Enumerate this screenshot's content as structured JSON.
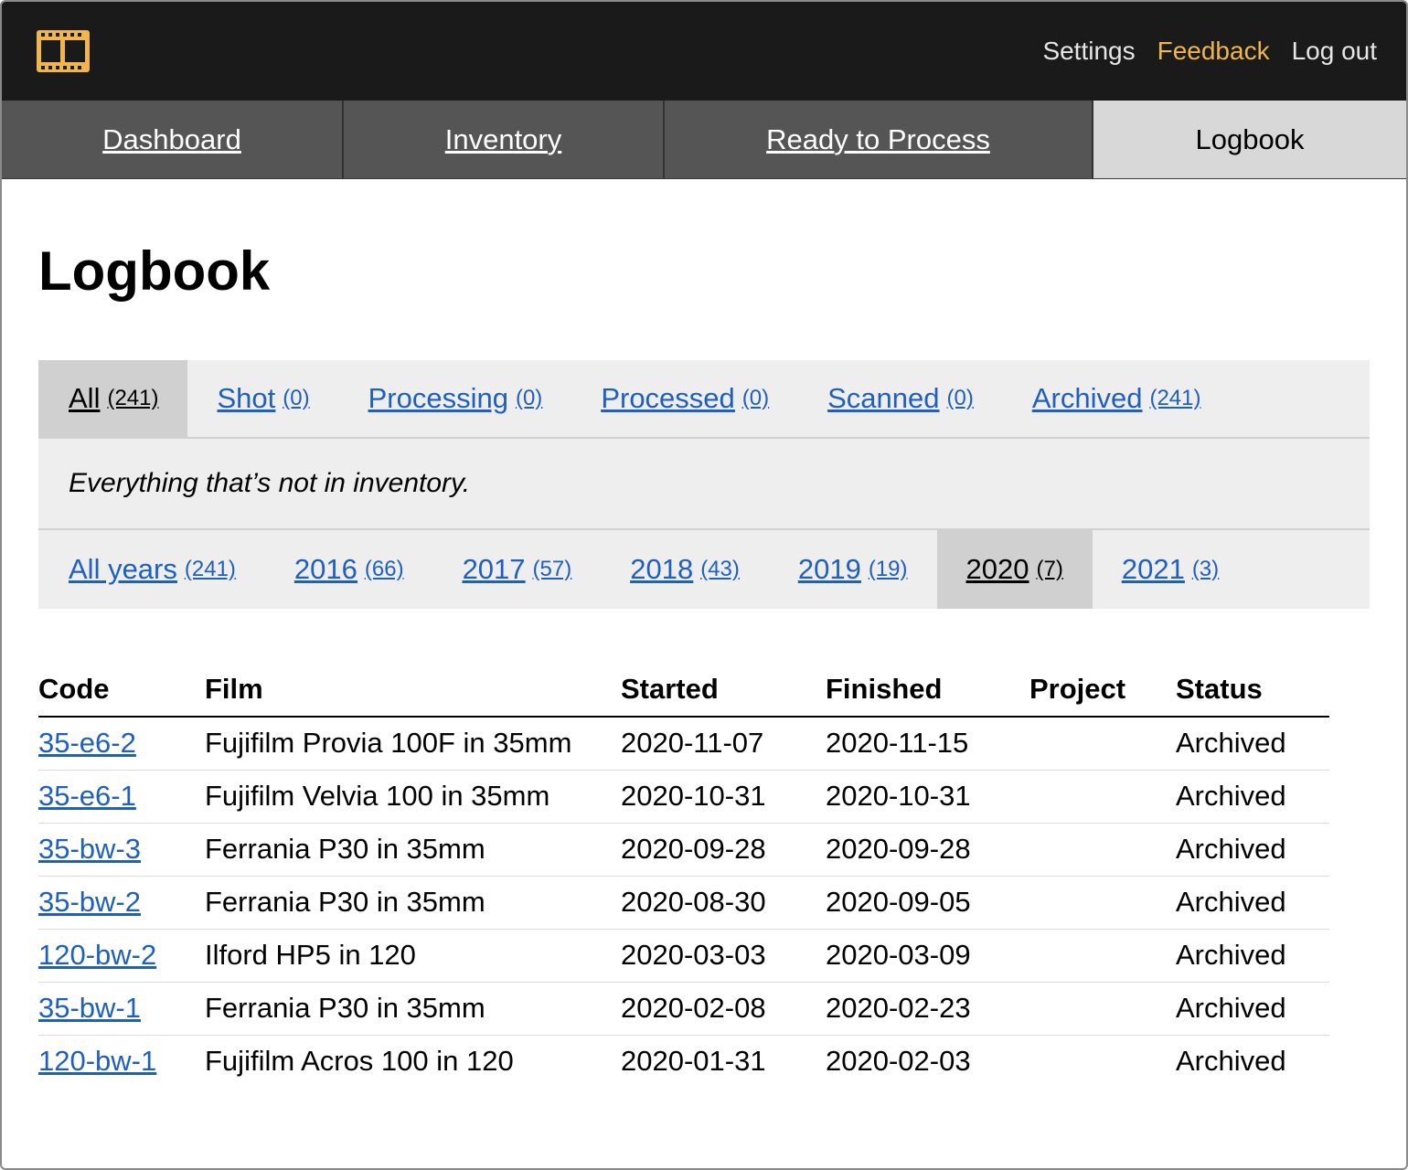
{
  "topbar": {
    "logo_icon": "film-strip-icon",
    "links": {
      "settings": "Settings",
      "feedback": "Feedback",
      "logout": "Log out"
    },
    "accent_color": "#f0b64b"
  },
  "nav": {
    "items": [
      {
        "label": "Dashboard"
      },
      {
        "label": "Inventory"
      },
      {
        "label": "Ready to Process"
      },
      {
        "label": "Logbook"
      }
    ],
    "active": "Logbook"
  },
  "page": {
    "title": "Logbook"
  },
  "status_tabs": [
    {
      "label": "All",
      "count": "(241)"
    },
    {
      "label": "Shot",
      "count": "(0)"
    },
    {
      "label": "Processing",
      "count": "(0)"
    },
    {
      "label": "Processed",
      "count": "(0)"
    },
    {
      "label": "Scanned",
      "count": "(0)"
    },
    {
      "label": "Archived",
      "count": "(241)"
    }
  ],
  "status_active": "All",
  "description": "Everything that’s not in inventory.",
  "year_tabs": [
    {
      "label": "All years",
      "count": "(241)"
    },
    {
      "label": "2016",
      "count": "(66)"
    },
    {
      "label": "2017",
      "count": "(57)"
    },
    {
      "label": "2018",
      "count": "(43)"
    },
    {
      "label": "2019",
      "count": "(19)"
    },
    {
      "label": "2020",
      "count": "(7)"
    },
    {
      "label": "2021",
      "count": "(3)"
    }
  ],
  "year_active": "2020",
  "table": {
    "headers": {
      "code": "Code",
      "film": "Film",
      "started": "Started",
      "finished": "Finished",
      "project": "Project",
      "status": "Status"
    },
    "rows": [
      {
        "code": "35-e6-2",
        "film": "Fujifilm Provia 100F in 35mm",
        "started": "2020-11-07",
        "finished": "2020-11-15",
        "project": "",
        "status": "Archived"
      },
      {
        "code": "35-e6-1",
        "film": "Fujifilm Velvia 100 in 35mm",
        "started": "2020-10-31",
        "finished": "2020-10-31",
        "project": "",
        "status": "Archived"
      },
      {
        "code": "35-bw-3",
        "film": "Ferrania P30 in 35mm",
        "started": "2020-09-28",
        "finished": "2020-09-28",
        "project": "",
        "status": "Archived"
      },
      {
        "code": "35-bw-2",
        "film": "Ferrania P30 in 35mm",
        "started": "2020-08-30",
        "finished": "2020-09-05",
        "project": "",
        "status": "Archived"
      },
      {
        "code": "120-bw-2",
        "film": "Ilford HP5 in 120",
        "started": "2020-03-03",
        "finished": "2020-03-09",
        "project": "",
        "status": "Archived"
      },
      {
        "code": "35-bw-1",
        "film": "Ferrania P30 in 35mm",
        "started": "2020-02-08",
        "finished": "2020-02-23",
        "project": "",
        "status": "Archived"
      },
      {
        "code": "120-bw-1",
        "film": "Fujifilm Acros 100 in 120",
        "started": "2020-01-31",
        "finished": "2020-02-03",
        "project": "",
        "status": "Archived"
      }
    ]
  }
}
